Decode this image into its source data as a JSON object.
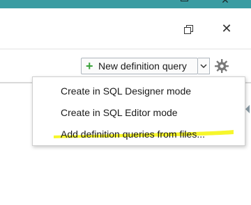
{
  "window": {
    "title_bar_color": "#3a9ca2",
    "maximize_icon": "window-maximize-icon",
    "close_icon": "window-close-icon"
  },
  "panel": {
    "restore_icon": "restore-window-icon",
    "close_icon": "close-icon"
  },
  "toolbar": {
    "new_query_label": "New definition query",
    "plus_icon": "plus-icon",
    "plus_color": "#3aa13a",
    "dropdown_icon": "chevron-down-icon",
    "settings_icon": "gear-icon"
  },
  "menu": {
    "items": [
      {
        "label": "Create in SQL Designer mode"
      },
      {
        "label": "Create in SQL Editor mode"
      },
      {
        "label": "Add definition queries from files..."
      }
    ],
    "highlight_color": "#f5f520"
  }
}
